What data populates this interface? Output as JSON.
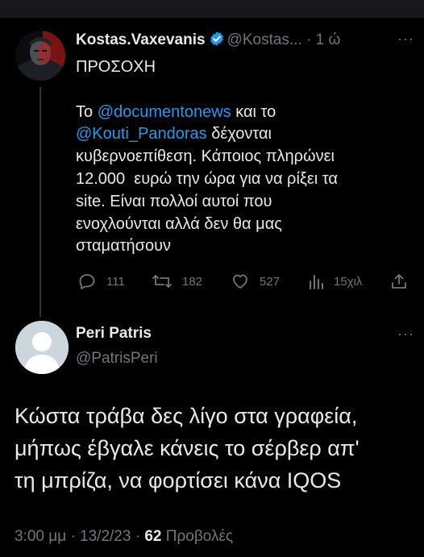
{
  "tweet": {
    "author_name": "Kostas.Vaxevanis",
    "handle": "@Kostas...",
    "separator": "·",
    "time": "1 ώ",
    "more": "···",
    "text_lines": [
      "ΠΡΟΣΟΧΗ",
      "",
      "Το ",
      "@documentonews",
      " και το",
      "@Kouti_Pandoras",
      " δέχονται",
      "κυβερνοεπίθεση. Κάποιος πληρώνει",
      "12.000  ευρώ την ώρα για να ρίξει τα",
      "site. Είναι πολλοί αυτοί που",
      "ενοχλούνται αλλά δεν θα μας",
      "σταματήσουν"
    ],
    "replies": "111",
    "retweets": "182",
    "likes": "527",
    "views": "15χιλ",
    "colors": {
      "mention": "#1d9bf0",
      "verified": "#1d9bf0",
      "muted": "#71767b"
    }
  },
  "reply": {
    "author_name": "Peri Patris",
    "handle": "@PatrisPeri",
    "more": "···",
    "text_lines": [
      "Κώστα τράβα δες λίγο στα γραφεία,",
      "μήπως έβγαλε κάνεις το σέρβερ απ'",
      "τη μπρίζα, να φορτίσει κάνα IQOS"
    ],
    "time": "3:00 μμ",
    "separator": "·",
    "date": "13/2/23",
    "views_count": "62",
    "views_label": "Προβολές"
  }
}
